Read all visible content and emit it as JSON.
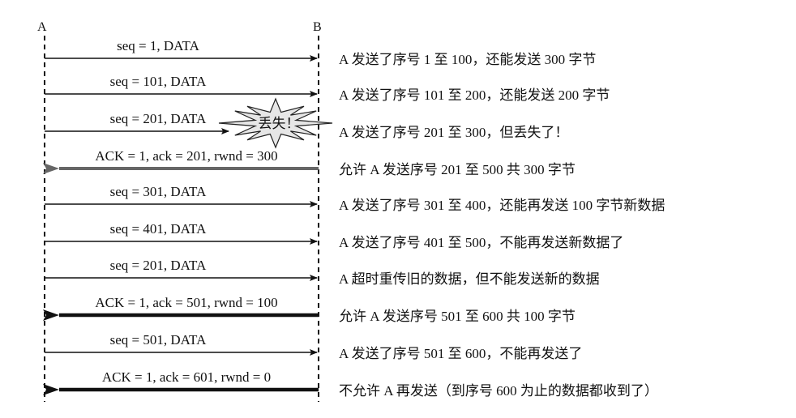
{
  "hosts": {
    "a": "A",
    "b": "B"
  },
  "lost_label": "丢失！",
  "colors": {
    "black": "#111111",
    "gray": "#666666",
    "burst_fill": "#e6e6e6"
  },
  "messages": [
    {
      "dir": "a-to-b",
      "label": "seq = 1, DATA",
      "desc": "A 发送了序号 1 至 100，还能发送 300 字节",
      "style": "thin"
    },
    {
      "dir": "a-to-b",
      "label": "seq = 101, DATA",
      "desc": "A 发送了序号 101 至 200，还能发送 200 字节",
      "style": "thin"
    },
    {
      "dir": "a-to-b",
      "label": "seq = 201, DATA",
      "desc": "A 发送了序号 201 至 300，但丢失了！",
      "style": "lost"
    },
    {
      "dir": "b-to-a",
      "label": "ACK = 1, ack = 201, rwnd = 300",
      "desc": "允许 A 发送序号 201 至 500  共 300 字节",
      "style": "gray"
    },
    {
      "dir": "a-to-b",
      "label": "seq = 301, DATA",
      "desc": "A 发送了序号 301 至 400，还能再发送 100 字节新数据",
      "style": "thin"
    },
    {
      "dir": "a-to-b",
      "label": "seq = 401, DATA",
      "desc": "A 发送了序号 401 至 500，不能再发送新数据了",
      "style": "thin"
    },
    {
      "dir": "a-to-b",
      "label": "seq = 201, DATA",
      "desc": "A 超时重传旧的数据，但不能发送新的数据",
      "style": "thin"
    },
    {
      "dir": "b-to-a",
      "label": "ACK = 1, ack = 501, rwnd = 100",
      "desc": "允许 A 发送序号 501 至 600 共 100 字节",
      "style": "thick"
    },
    {
      "dir": "a-to-b",
      "label": "seq = 501, DATA",
      "desc": "A 发送了序号 501 至 600，不能再发送了",
      "style": "thin"
    },
    {
      "dir": "b-to-a",
      "label": "ACK = 1, ack = 601, rwnd = 0",
      "desc": "不允许 A 再发送（到序号 600 为止的数据都收到了）",
      "style": "thick"
    }
  ]
}
